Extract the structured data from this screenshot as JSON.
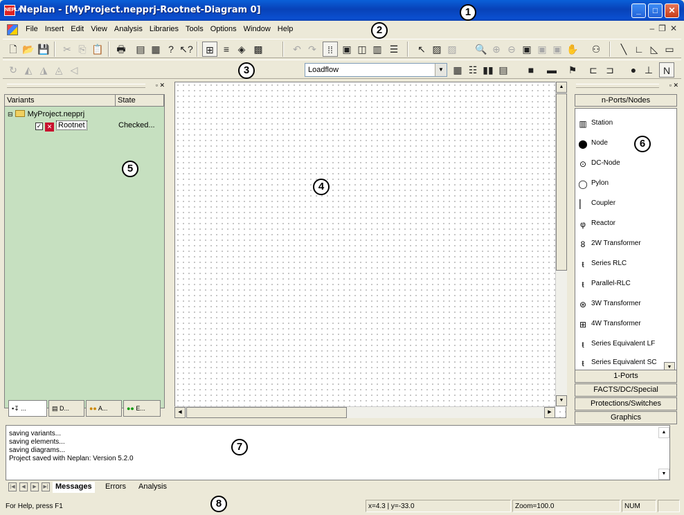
{
  "window": {
    "title": "Neplan - [MyProject.nepprj-Rootnet-Diagram 0]",
    "app_icon": "NEPLAN"
  },
  "menu": {
    "items": [
      "File",
      "Insert",
      "Edit",
      "View",
      "Analysis",
      "Libraries",
      "Tools",
      "Options",
      "Window",
      "Help"
    ]
  },
  "callouts": [
    "1",
    "2",
    "3",
    "4",
    "5",
    "6",
    "7",
    "8"
  ],
  "toolbar": {
    "calc_select": "Loadflow"
  },
  "variants": {
    "col_variants": "Variants",
    "col_state": "State",
    "project": "MyProject.nepprj",
    "net": "Rootnet",
    "net_state": "Checked..."
  },
  "left_tabs": [
    "...",
    "D...",
    "A...",
    "E..."
  ],
  "symbols": {
    "header": "n-Ports/Nodes",
    "items": [
      "Station",
      "Node",
      "DC-Node",
      "Pylon",
      "Coupler",
      "Reactor",
      "2W Transformer",
      "Series RLC",
      "Parallel-RLC",
      "3W Transformer",
      "4W Transformer",
      "Series Equivalent LF",
      "Series Equivalent SC"
    ],
    "groups": [
      "1-Ports",
      "FACTS/DC/Special",
      "Protections/Switches",
      "Graphics"
    ]
  },
  "messages": {
    "lines": [
      "saving variants...",
      "saving elements...",
      "saving diagrams...",
      "Project saved with Neplan: Version 5.2.0"
    ],
    "tabs": [
      "Messages",
      "Errors",
      "Analysis"
    ]
  },
  "status": {
    "help": "For Help, press F1",
    "coords": "x=4.3 | y=-33.0",
    "zoom": "Zoom=100.0",
    "num": "NUM"
  },
  "colors": {
    "variants_bg": "#c6e0c0",
    "titlebar": "#0a4fd0",
    "close_button": "#c63c19"
  }
}
